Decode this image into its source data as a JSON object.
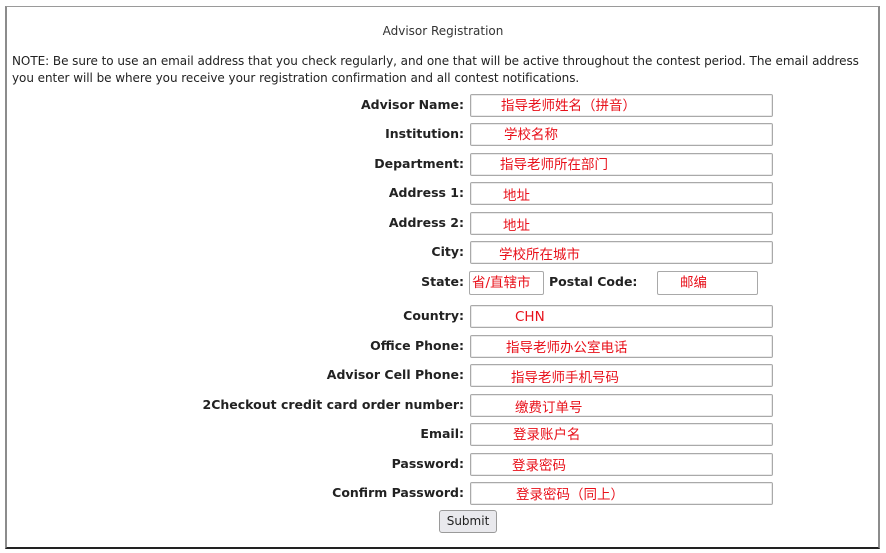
{
  "page": {
    "title": "Advisor Registration",
    "note": "NOTE: Be sure to use an email address that you check regularly, and one that will be active throughout the contest period. The email address you enter will be where you receive your registration confirmation and all contest notifications."
  },
  "form": {
    "fields": [
      {
        "label": "Advisor Name:",
        "value": "指导老师姓名（拼音）"
      },
      {
        "label": "Institution:",
        "value": "学校名称"
      },
      {
        "label": "Department:",
        "value": "指导老师所在部门"
      },
      {
        "label": "Address 1:",
        "value": "地址"
      },
      {
        "label": "Address 2:",
        "value": "地址"
      },
      {
        "label": "City:",
        "value": "学校所在城市"
      }
    ],
    "state": {
      "label": "State:",
      "value": "省/直辖市"
    },
    "postal_code": {
      "label": "Postal Code:",
      "value": "邮编"
    },
    "fields2": [
      {
        "label": "Country:",
        "value": "CHN"
      },
      {
        "label": "Office Phone:",
        "value": "指导老师办公室电话"
      },
      {
        "label": "Advisor Cell Phone:",
        "value": "指导老师手机号码"
      },
      {
        "label": "2Checkout credit card order number:",
        "value": "缴费订单号"
      },
      {
        "label": "Email:",
        "value": "登录账户名"
      },
      {
        "label": "Password:",
        "value": "登录密码"
      },
      {
        "label": "Confirm Password:",
        "value": "登录密码（同上）"
      }
    ],
    "submit_label": "Submit"
  },
  "colors": {
    "annotation_text": "#e8101a",
    "label_text": "#222222",
    "input_border": "#a9a9a9",
    "button_bg": "#e9e9ed"
  }
}
